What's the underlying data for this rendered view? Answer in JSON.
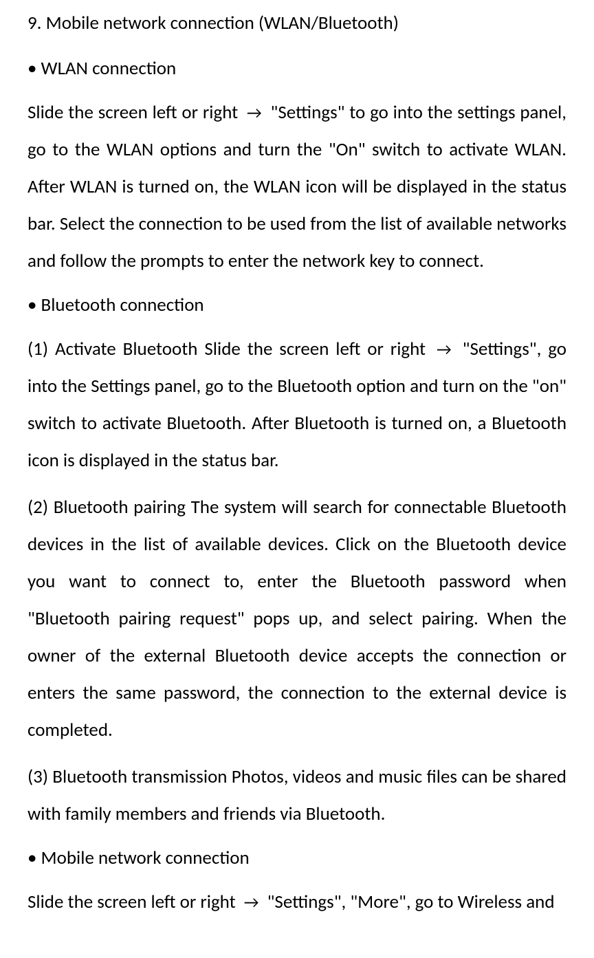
{
  "heading": "9. Mobile network connection (WLAN/Bluetooth)",
  "bullets": {
    "wlan": "• WLAN connection",
    "bluetooth": "• Bluetooth connection",
    "mobile": "• Mobile network connection"
  },
  "paragraphs": {
    "wlan_body_1": "Slide the screen left or right ",
    "wlan_body_2": " \"Settings\" to go into the settings panel, go to the WLAN options and turn the \"On\" switch to activate WLAN. After WLAN is turned on, the WLAN icon will be displayed in the status bar. Select the connection to be used from the list of available networks and follow the prompts to enter the network key to connect.",
    "bt1_1": "(1) Activate Bluetooth Slide the screen left or right ",
    "bt1_2": " \"Settings\", go into the Settings panel, go to the Bluetooth option and turn on the \"on\" switch to activate Bluetooth. After Bluetooth is turned on, a Bluetooth icon is displayed in the status bar.",
    "bt2": "(2) Bluetooth pairing The system will search for connectable Bluetooth devices in the list of available devices. Click on the Bluetooth device you want to connect to, enter the Bluetooth password when \"Bluetooth pairing request\" pops up, and select pairing. When the owner of the external Bluetooth device accepts the connection or enters the same password, the connection to the external device is completed.",
    "bt3": "(3) Bluetooth transmission Photos, videos and music files can be shared with family members and friends via Bluetooth.",
    "mobile_1": "Slide the screen left or right ",
    "mobile_2": " \"Settings\", \"More\", go to Wireless and"
  },
  "arrow": "→"
}
